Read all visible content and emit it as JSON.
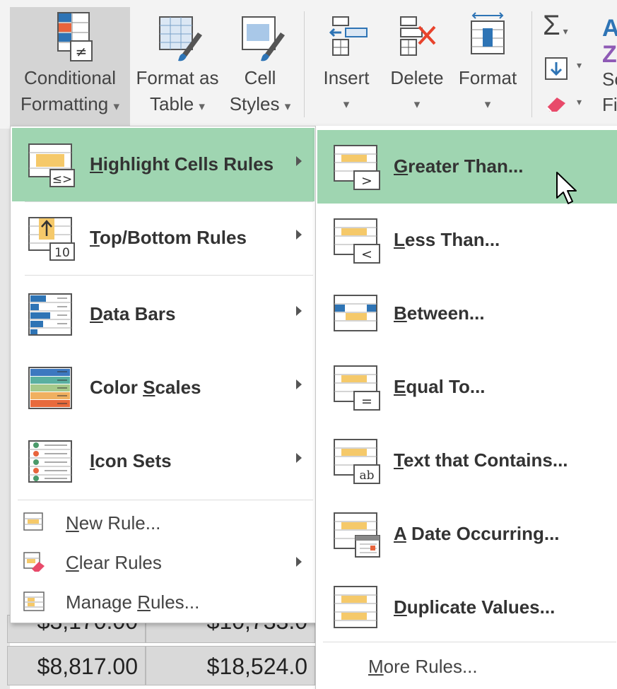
{
  "ribbon": {
    "buttons": [
      {
        "line1": "Conditional",
        "line2": "Formatting",
        "caret": "▾",
        "icon": "conditional-formatting-icon"
      },
      {
        "line1": "Format as",
        "line2": "Table",
        "caret": "▾",
        "icon": "format-as-table-icon"
      },
      {
        "line1": "Cell",
        "line2": "Styles",
        "caret": "▾",
        "icon": "cell-styles-icon"
      },
      {
        "line1": "Insert",
        "line2": "",
        "caret": "▾",
        "icon": "insert-cells-icon"
      },
      {
        "line1": "Delete",
        "line2": "",
        "caret": "▾",
        "icon": "delete-cells-icon"
      },
      {
        "line1": "Format",
        "line2": "",
        "caret": "▾",
        "icon": "format-cells-icon"
      }
    ],
    "editing": {
      "sum_symbol": "Σ",
      "sort_partial": "So",
      "find_partial": "Fi"
    }
  },
  "menu": {
    "items": [
      {
        "pre": "",
        "key": "H",
        "post": "ighlight Cells Rules",
        "icon": "highlight-cells-rules-icon",
        "badge": "≤>",
        "highlighted": true
      },
      {
        "pre": "",
        "key": "T",
        "post": "op/Bottom Rules",
        "icon": "top-bottom-rules-icon",
        "badge": "10"
      },
      {
        "pre": "",
        "key": "D",
        "post": "ata Bars",
        "icon": "data-bars-icon"
      },
      {
        "pre": "Color ",
        "key": "S",
        "post": "cales",
        "icon": "color-scales-icon"
      },
      {
        "pre": "",
        "key": "I",
        "post": "con Sets",
        "icon": "icon-sets-icon"
      }
    ],
    "small_items": [
      {
        "pre": "",
        "key": "N",
        "post": "ew Rule...",
        "icon": "new-rule-icon"
      },
      {
        "pre": "",
        "key": "C",
        "post": "lear Rules",
        "icon": "clear-rules-icon"
      },
      {
        "pre": "Manage ",
        "key": "R",
        "post": "ules...",
        "icon": "manage-rules-icon"
      }
    ]
  },
  "submenu": {
    "items": [
      {
        "pre": "",
        "key": "G",
        "post": "reater Than...",
        "badge": ">",
        "icon": "greater-than-icon",
        "highlighted": true
      },
      {
        "pre": "",
        "key": "L",
        "post": "ess Than...",
        "badge": "<",
        "icon": "less-than-icon"
      },
      {
        "pre": "",
        "key": "B",
        "post": "etween...",
        "badge": "",
        "icon": "between-icon"
      },
      {
        "pre": "",
        "key": "E",
        "post": "qual To...",
        "badge": "=",
        "icon": "equal-to-icon"
      },
      {
        "pre": "",
        "key": "T",
        "post": "ext that Contains...",
        "badge": "ab",
        "icon": "text-contains-icon"
      },
      {
        "pre": "",
        "key": "A",
        "post": " Date Occurring...",
        "badge": "",
        "icon": "date-occurring-icon"
      },
      {
        "pre": "",
        "key": "D",
        "post": "uplicate Values...",
        "badge": "",
        "icon": "duplicate-values-icon"
      }
    ],
    "more": {
      "pre": "",
      "key": "M",
      "post": "ore Rules..."
    }
  },
  "sheet": {
    "rows": [
      [
        "$3,170.00",
        "$10,733.0"
      ],
      [
        "$8,817.00",
        "$18,524.0"
      ]
    ]
  },
  "colors": {
    "highlight": "#9fd5b1",
    "ribbon_bg": "#f3f3f3",
    "accent_orange": "#e8a33c",
    "accent_blue": "#2e74b5"
  }
}
